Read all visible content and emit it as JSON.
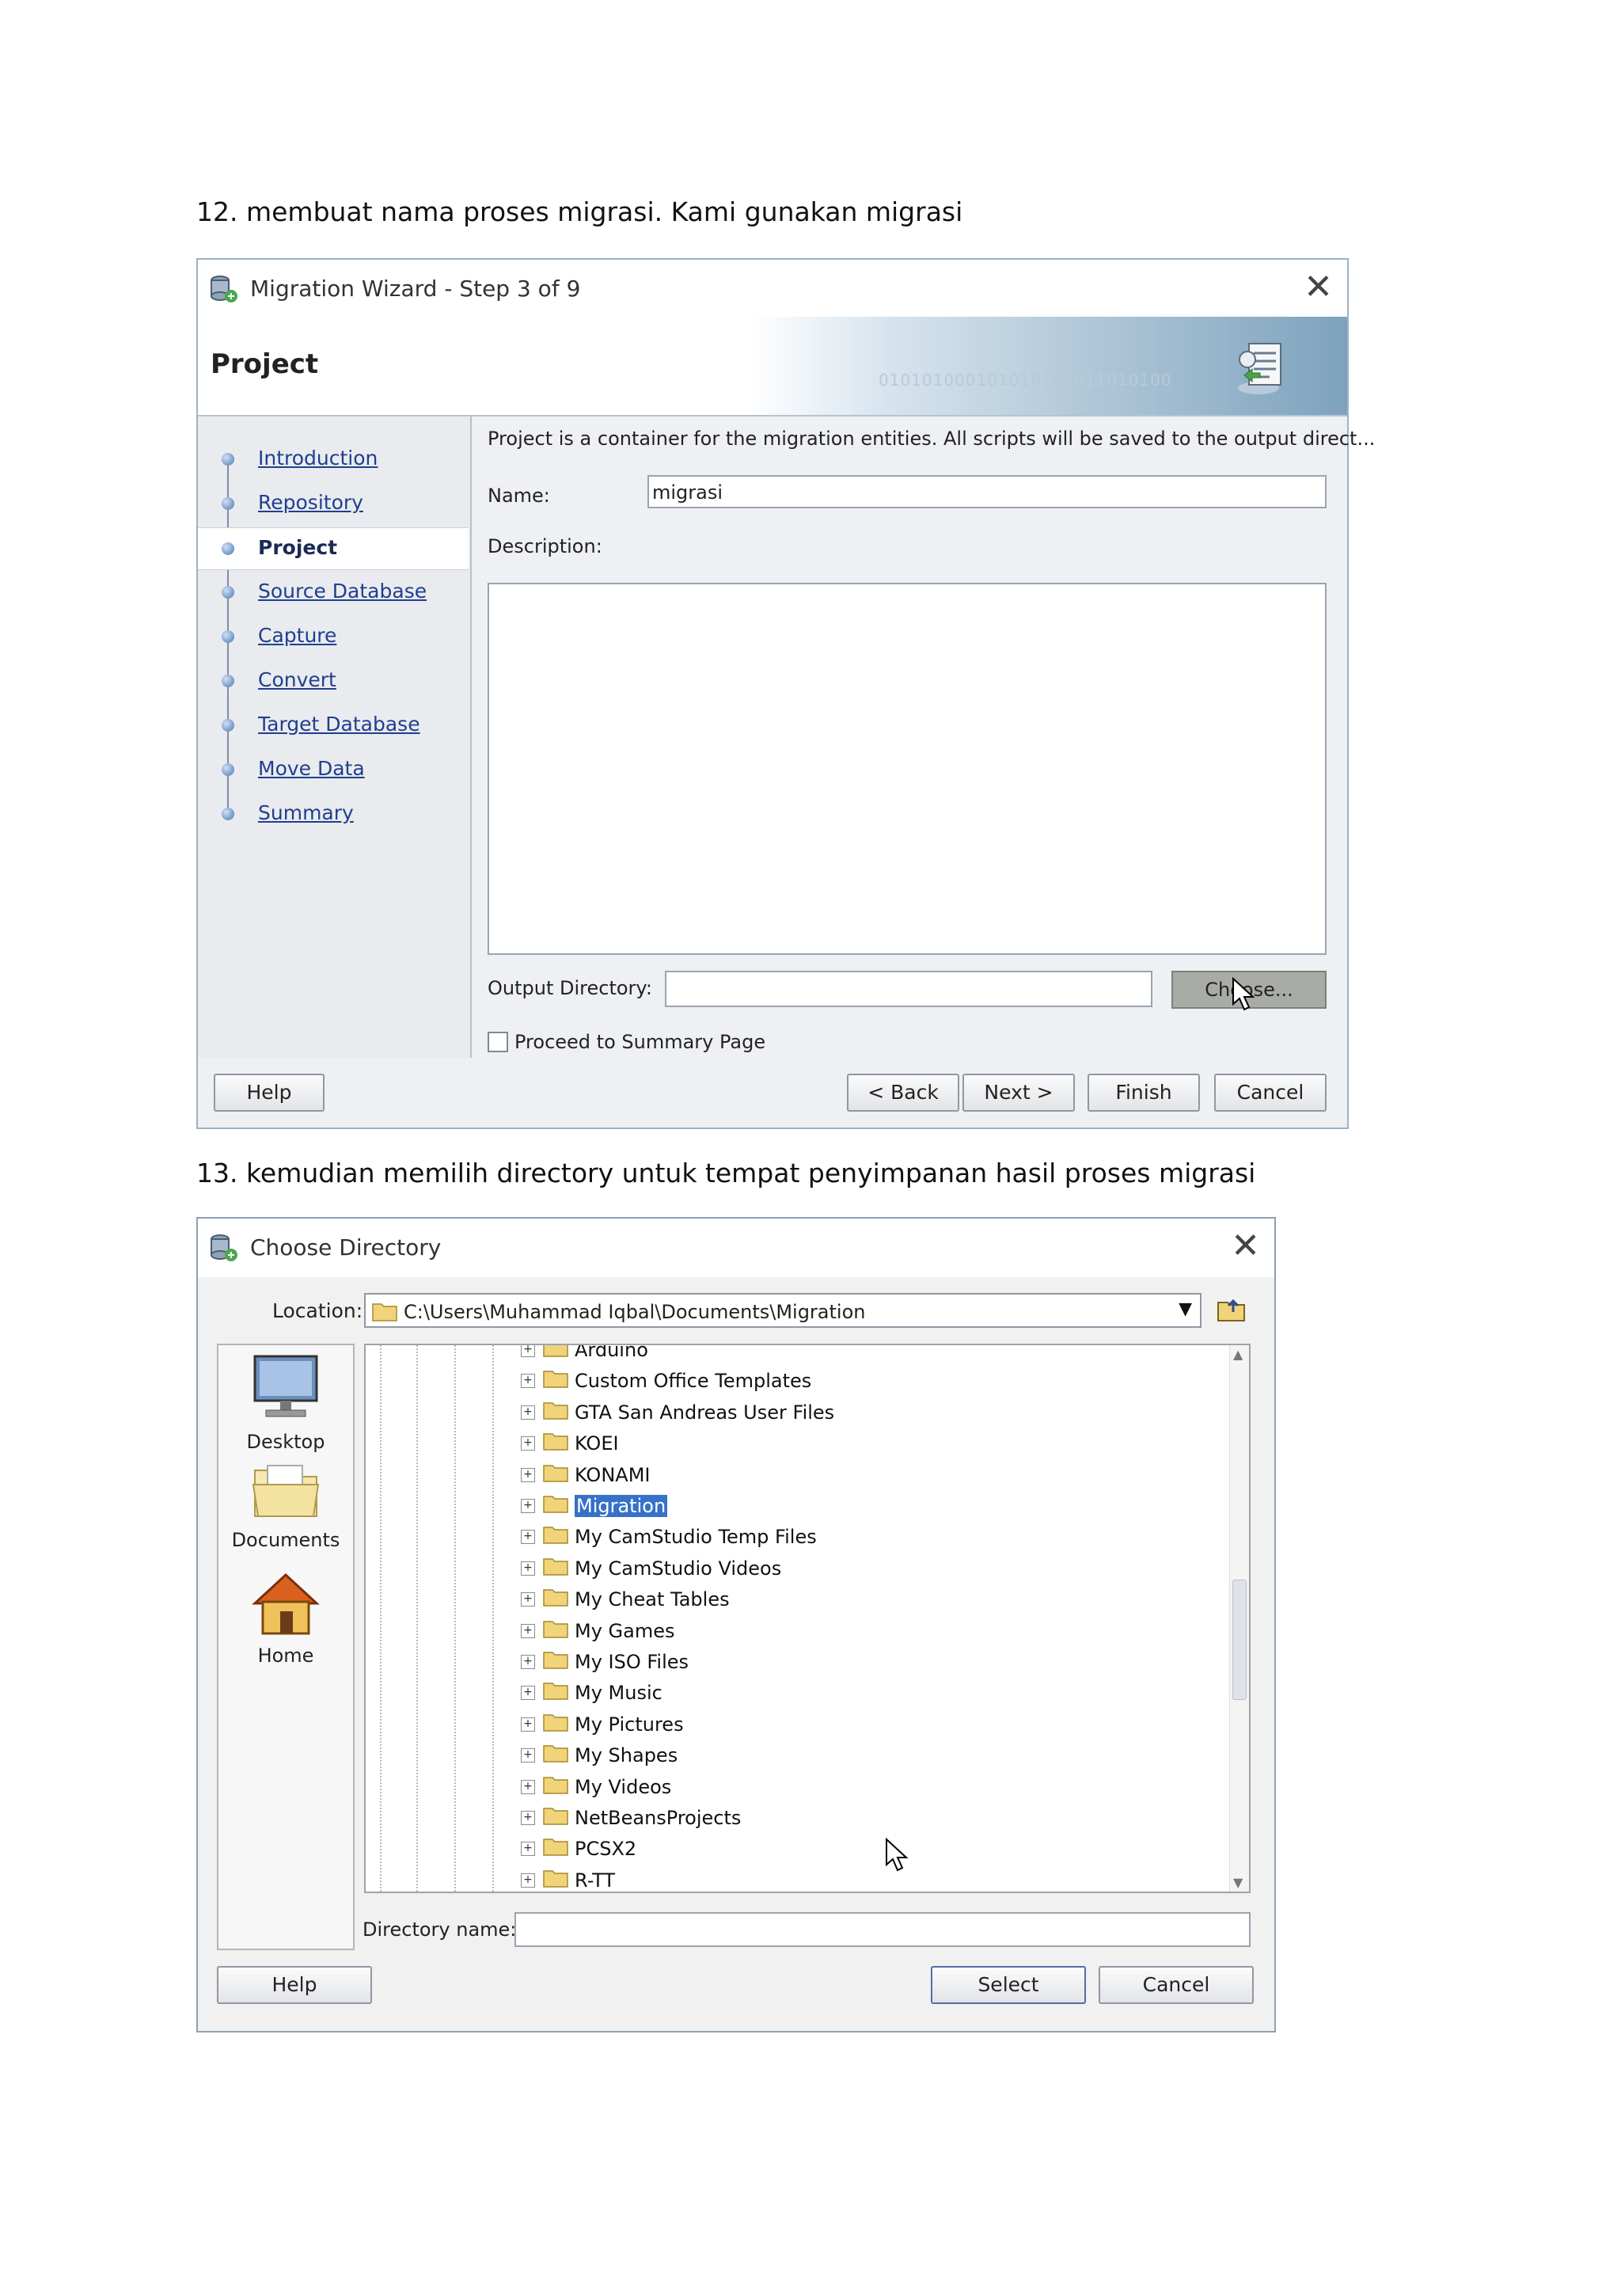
{
  "doc": {
    "step12": "12. membuat nama proses migrasi. Kami gunakan migrasi",
    "step13": "13. kemudian memilih directory untuk tempat penyimpanan hasil proses migrasi"
  },
  "wizard": {
    "window_title": "Migration Wizard - Step 3 of 9",
    "page_title": "Project",
    "banner_bits": "010101000101010101011010100",
    "steps": [
      {
        "label": "Introduction",
        "active": false
      },
      {
        "label": "Repository",
        "active": false
      },
      {
        "label": "Project",
        "active": true
      },
      {
        "label": "Source Database",
        "active": false
      },
      {
        "label": "Capture ",
        "active": false
      },
      {
        "label": "Convert",
        "active": false
      },
      {
        "label": "Target Database",
        "active": false
      },
      {
        "label": "Move Data",
        "active": false
      },
      {
        "label": "Summary",
        "active": false
      }
    ],
    "intro_text": "Project is a container for the migration entities.  All scripts will be saved to the output direct...",
    "name_label": "Name:",
    "name_value": "migrasi",
    "description_label": "Description:",
    "description_value": "",
    "output_dir_label": "Output Directory:",
    "output_dir_value": "",
    "choose_label": "Choose...",
    "proceed_label": "Proceed to Summary Page",
    "proceed_checked": false,
    "buttons": {
      "help": "Help",
      "back": "< Back",
      "next": "Next >",
      "finish": "Finish",
      "cancel": "Cancel"
    }
  },
  "chooser": {
    "window_title": "Choose Directory",
    "location_label": "Location:",
    "location_path": "C:\\Users\\Muhammad Iqbal\\Documents\\Migration",
    "shortcuts": [
      "Desktop",
      "Documents",
      "Home"
    ],
    "folders": [
      {
        "name": "Arduino",
        "selected": false
      },
      {
        "name": "Custom Office Templates",
        "selected": false
      },
      {
        "name": "GTA San Andreas User Files",
        "selected": false
      },
      {
        "name": "KOEI",
        "selected": false
      },
      {
        "name": "KONAMI",
        "selected": false
      },
      {
        "name": "Migration",
        "selected": true
      },
      {
        "name": "My CamStudio Temp Files",
        "selected": false
      },
      {
        "name": "My CamStudio Videos",
        "selected": false
      },
      {
        "name": "My Cheat Tables",
        "selected": false
      },
      {
        "name": "My Games",
        "selected": false
      },
      {
        "name": "My ISO Files",
        "selected": false
      },
      {
        "name": "My Music",
        "selected": false
      },
      {
        "name": "My Pictures",
        "selected": false
      },
      {
        "name": "My Shapes",
        "selected": false
      },
      {
        "name": "My Videos",
        "selected": false
      },
      {
        "name": "NetBeansProjects",
        "selected": false
      },
      {
        "name": "PCSX2",
        "selected": false
      },
      {
        "name": "R-TT",
        "selected": false
      }
    ],
    "directory_name_label": "Directory name:",
    "directory_name_value": "",
    "buttons": {
      "help": "Help",
      "select": "Select",
      "cancel": "Cancel"
    }
  },
  "colors": {
    "link": "#1f3f8f",
    "selection": "#3572c8",
    "banner_dark": "#7ea2bd"
  },
  "icons": [
    "app-database-icon",
    "close-icon",
    "wizard-banner-icon",
    "step-node-icon",
    "folder-icon",
    "up-folder-icon",
    "desktop-icon",
    "documents-icon",
    "home-icon",
    "expand-icon",
    "mouse-cursor-icon",
    "dropdown-arrow-icon"
  ]
}
